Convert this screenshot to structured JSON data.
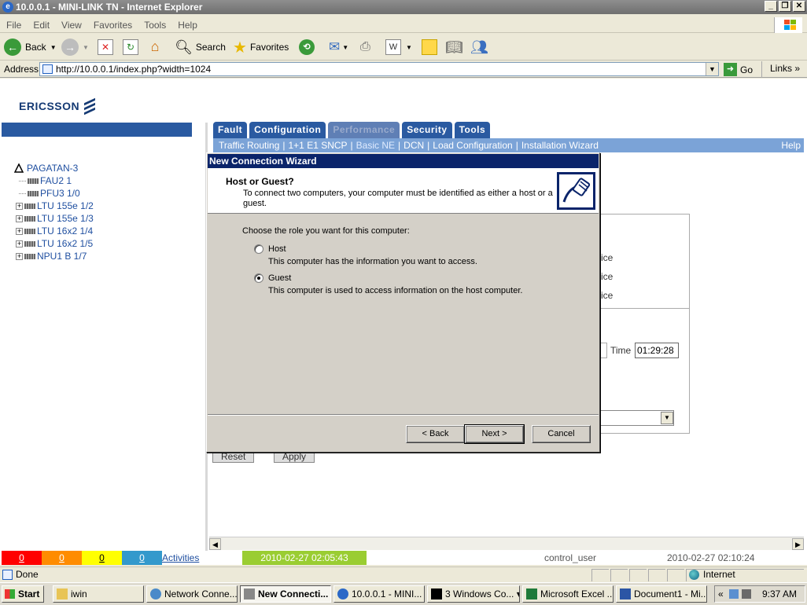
{
  "window": {
    "title": "10.0.0.1 - MINI-LINK TN - Internet Explorer",
    "menu": [
      "File",
      "Edit",
      "View",
      "Favorites",
      "Tools",
      "Help"
    ]
  },
  "toolbar": {
    "back_label": "Back",
    "search_label": "Search",
    "favorites_label": "Favorites"
  },
  "address": {
    "label": "Address",
    "url": "http://10.0.0.1/index.php?width=1024",
    "go_label": "Go",
    "links_label": "Links"
  },
  "page": {
    "logo_text": "ERICSSON",
    "tree": [
      {
        "label": "PAGATAN-3",
        "kind": "root"
      },
      {
        "label": "FAU2 1",
        "kind": "leaf"
      },
      {
        "label": "PFU3 1/0",
        "kind": "leaf"
      },
      {
        "label": "LTU 155e 1/2",
        "kind": "expandable"
      },
      {
        "label": "LTU 155e 1/3",
        "kind": "expandable"
      },
      {
        "label": "LTU 16x2 1/4",
        "kind": "expandable"
      },
      {
        "label": "LTU 16x2 1/5",
        "kind": "expandable"
      },
      {
        "label": "NPU1 B 1/7",
        "kind": "expandable"
      }
    ],
    "tabs": [
      {
        "label": "Fault",
        "disabled": false
      },
      {
        "label": "Configuration",
        "disabled": false
      },
      {
        "label": "Performance",
        "disabled": true
      },
      {
        "label": "Security",
        "disabled": false
      },
      {
        "label": "Tools",
        "disabled": false
      }
    ],
    "subnav": [
      "Traffic Routing",
      "1+1 E1 SNCP",
      "Basic NE",
      "DCN",
      "Load Configuration",
      "Installation Wizard"
    ],
    "subnav_active": "Basic NE",
    "help_label": "Help",
    "bg_fragments": [
      "ice",
      "ice",
      "ice"
    ],
    "time_label": "Time",
    "time_value": "01:29:28",
    "reset_label": "Reset",
    "apply_label": "Apply"
  },
  "status_strip": {
    "counters": [
      {
        "value": "0",
        "color": "#ff0000"
      },
      {
        "value": "0",
        "color": "#ff8c00"
      },
      {
        "value": "0",
        "color": "#ffff00"
      },
      {
        "value": "0",
        "color": "#3399cc"
      }
    ],
    "activities_label": "Activities",
    "timestamp_left": "2010-02-27 02:05:43",
    "user": "control_user",
    "timestamp_right": "2010-02-27 02:10:24"
  },
  "ie_status": {
    "text": "Done",
    "zone": "Internet"
  },
  "dialog": {
    "title": "New Connection Wizard",
    "header_title": "Host or Guest?",
    "header_subtitle": "To connect two computers, your computer must be identified as either a host or a guest.",
    "prompt": "Choose the role you want for this computer:",
    "options": [
      {
        "label": "Host",
        "description": "This computer has the information you want to access.",
        "selected": false
      },
      {
        "label": "Guest",
        "description": "This computer is used to access information on the host computer.",
        "selected": true
      }
    ],
    "back_label": "< Back",
    "next_label": "Next >",
    "cancel_label": "Cancel"
  },
  "taskbar": {
    "start_label": "Start",
    "tasks": [
      {
        "label": "iwin",
        "active": false
      },
      {
        "label": "Network Conne...",
        "active": false
      },
      {
        "label": "New Connecti...",
        "active": true
      },
      {
        "label": "10.0.0.1 - MINI...",
        "active": false
      },
      {
        "label": "3 Windows Co...",
        "active": false
      },
      {
        "label": "Microsoft Excel ...",
        "active": false
      },
      {
        "label": "Document1 - Mi...",
        "active": false
      }
    ],
    "clock": "9:37 AM"
  }
}
